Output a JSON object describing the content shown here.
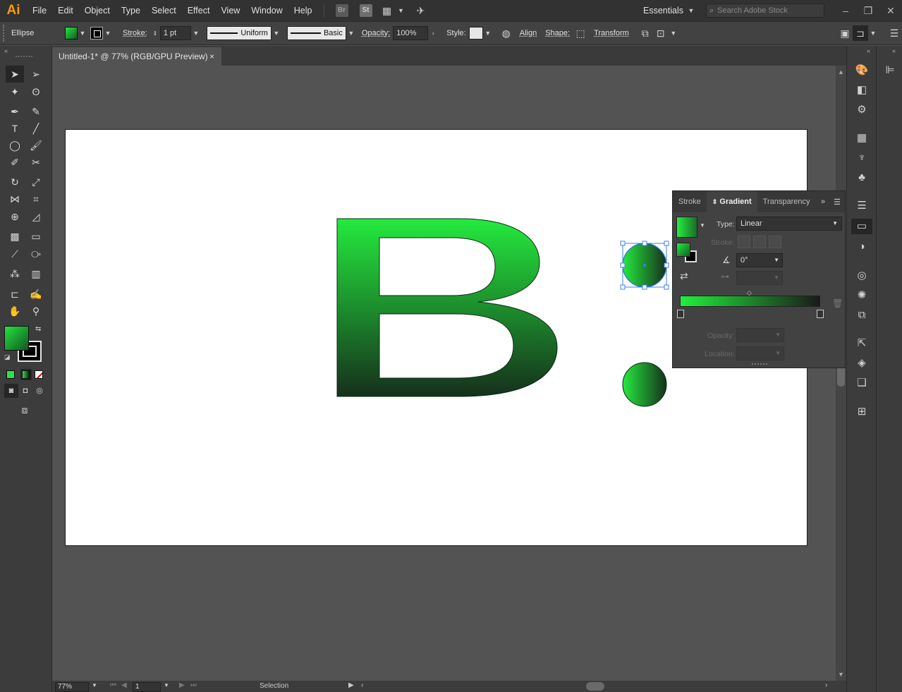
{
  "app": {
    "logo": "Ai",
    "menu": [
      "File",
      "Edit",
      "Object",
      "Type",
      "Select",
      "Effect",
      "View",
      "Window",
      "Help"
    ],
    "bridge_label": "Br",
    "stock_label": "St",
    "workspace": "Essentials",
    "search_placeholder": "Search Adobe Stock"
  },
  "control_bar": {
    "selection_type": "Ellipse",
    "stroke_label": "Stroke:",
    "stroke_weight": "1 pt",
    "profile": "Uniform",
    "brush": "Basic",
    "opacity_label": "Opacity:",
    "opacity": "100%",
    "style_label": "Style:",
    "align_label": "Align",
    "shape_label": "Shape:",
    "transform_label": "Transform"
  },
  "document": {
    "tab_title": "Untitled-1* @ 77% (RGB/GPU Preview)",
    "close_glyph": "×"
  },
  "artwork": {
    "letter": "B",
    "gradient_start": "#24ea3e",
    "gradient_end": "#16301c"
  },
  "gradient_panel": {
    "tabs": [
      "Stroke",
      "Gradient",
      "Transparency"
    ],
    "active_tab": "Gradient",
    "type_label": "Type:",
    "type_value": "Linear",
    "stroke_label": "Stroke:",
    "angle_value": "0°",
    "opacity_label": "Opacity:",
    "location_label": "Location:",
    "ramp_start": "#21f03c",
    "ramp_end": "#1a1a1a"
  },
  "status_bar": {
    "zoom": "77%",
    "page": "1",
    "tool": "Selection"
  }
}
